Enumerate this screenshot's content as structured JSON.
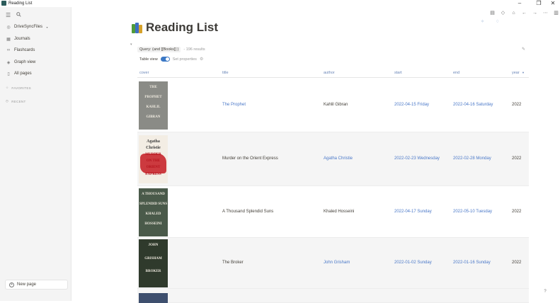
{
  "window": {
    "title": "Reading List",
    "controls": {
      "minimize": "–",
      "maximize": "❐",
      "close": "✕"
    }
  },
  "sidebar": {
    "workspace": "DriveSyncFiles",
    "items": [
      {
        "label": "Journals",
        "icon": "calendar-icon"
      },
      {
        "label": "Flashcards",
        "icon": "infinity-icon"
      },
      {
        "label": "Graph view",
        "icon": "graph-icon"
      },
      {
        "label": "All pages",
        "icon": "pages-icon"
      }
    ],
    "sections": {
      "favorites": "FAVORITES",
      "recent": "RECENT"
    },
    "new_page": "New page"
  },
  "page": {
    "title": "Reading List"
  },
  "query": {
    "expression": "Query: (and [[Books]] )",
    "count": "- 196 results",
    "table_view_label": "Table view",
    "set_properties_label": "Set properties"
  },
  "table": {
    "columns": {
      "cover": "cover",
      "title": "title",
      "author": "author",
      "start": "start",
      "end": "end",
      "year": "year"
    },
    "rows": [
      {
        "title": "The Prophet",
        "title_link": true,
        "author": "Kahlil Gibran",
        "author_link": false,
        "start": "2022-04-15 Friday",
        "end": "2022-04-16 Saturday",
        "year": "2022",
        "cover_text": [
          "THE",
          "PROPHET",
          "KAHLIL",
          "GIBRAN"
        ],
        "cover_color": "#8a8b86"
      },
      {
        "title": "Murder on the Orient Express",
        "title_link": false,
        "author": "Agatha Christie",
        "author_link": true,
        "start": "2022-02-23 Wednesday",
        "end": "2022-02-28 Monday",
        "year": "2022",
        "cover_text": [
          "Agatha",
          "Christie",
          "MURDER",
          "ON THE",
          "ORIENT",
          "EXPRESS"
        ],
        "cover_color": "#f3ede4"
      },
      {
        "title": "A Thousand Splendid Suns",
        "title_link": false,
        "author": "Khaled Hosseini",
        "author_link": false,
        "start": "2022-04-17 Sunday",
        "end": "2022-05-10 Tuesday",
        "year": "2022",
        "cover_text": [
          "A THOUSAND",
          "SPLENDID SUNS",
          "KHALED",
          "HOSSEINI"
        ],
        "cover_color": "#4a5a4a"
      },
      {
        "title": "The Broker",
        "title_link": false,
        "author": "John Grisham",
        "author_link": true,
        "start": "2022-01-02 Sunday",
        "end": "2022-01-16 Sunday",
        "year": "2022",
        "cover_text": [
          "JOHN",
          "GRISHAM",
          "BROKER"
        ],
        "cover_color": "#2f3a2c"
      }
    ]
  },
  "colors": {
    "accent": "#3b78c5",
    "link": "#4a78c8",
    "sidebar_bg": "#f4f4f4",
    "row_alt": "#f5f5f5"
  }
}
